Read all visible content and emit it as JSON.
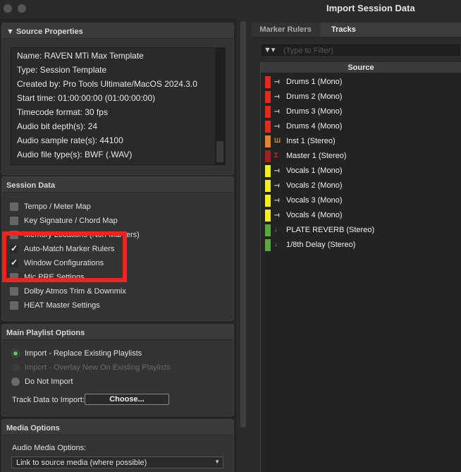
{
  "window": {
    "title": "Import Session Data"
  },
  "source_properties": {
    "header": "▼ Source Properties",
    "lines": [
      "Name: RAVEN MTi Max Template",
      "Type: Session Template",
      "Created by: Pro Tools Ultimate/MacOS 2024.3.0",
      "Start time: 01:00:00:00 (01:00:00:00)",
      "Timecode format: 30 fps",
      "Audio bit depth(s): 24",
      "Audio sample rate(s): 44100",
      "Audio file type(s): BWF (.WAV)"
    ]
  },
  "session_data": {
    "header": "Session Data",
    "items": [
      {
        "label": "Tempo / Meter Map",
        "checked": false
      },
      {
        "label": "Key Signature / Chord Map",
        "checked": false
      },
      {
        "label": "Memory Locations (Non-Markers)",
        "checked": false
      },
      {
        "label": "Auto-Match Marker Rulers",
        "checked": true
      },
      {
        "label": "Window Configurations",
        "checked": true
      },
      {
        "label": "Mic PRE Settings",
        "checked": false
      },
      {
        "label": "Dolby Atmos Trim & Downmix",
        "checked": false
      },
      {
        "label": "HEAT Master Settings",
        "checked": false
      }
    ]
  },
  "main_playlist": {
    "header": "Main Playlist Options",
    "options": [
      {
        "label": "Import - Replace Existing Playlists",
        "state": "selected"
      },
      {
        "label": "Import - Overlay New On Existing Playlists",
        "state": "disabled"
      },
      {
        "label": "Do Not Import",
        "state": "unselected"
      }
    ],
    "track_data_label": "Track Data to Import:",
    "choose_label": "Choose..."
  },
  "media_options": {
    "header": "Media Options",
    "audio_media_label": "Audio Media Options:",
    "audio_media_value": "Link to source media (where possible)"
  },
  "tabs": {
    "marker_rulers": "Marker Rulers",
    "tracks": "Tracks"
  },
  "filter": {
    "placeholder": "(Type to Filter)"
  },
  "tracks": {
    "header": "Source",
    "items": [
      {
        "name": "Drums 1 (Mono)",
        "color": "#e8281e",
        "icon": "audio-track-icon"
      },
      {
        "name": "Drums 2 (Mono)",
        "color": "#e8281e",
        "icon": "audio-track-icon"
      },
      {
        "name": "Drums 3 (Mono)",
        "color": "#e8281e",
        "icon": "audio-track-icon"
      },
      {
        "name": "Drums 4 (Mono)",
        "color": "#e8281e",
        "icon": "audio-track-icon"
      },
      {
        "name": "Inst 1 (Stereo)",
        "color": "#e0852a",
        "icon": "instrument-track-icon"
      },
      {
        "name": "Master 1 (Stereo)",
        "color": "#a51f1f",
        "icon": "master-track-icon"
      },
      {
        "name": "Vocals 1 (Mono)",
        "color": "#f2ef1e",
        "icon": "audio-track-icon"
      },
      {
        "name": "Vocals 2 (Mono)",
        "color": "#f2ef1e",
        "icon": "audio-track-icon"
      },
      {
        "name": "Vocals 3 (Mono)",
        "color": "#f2ef1e",
        "icon": "audio-track-icon"
      },
      {
        "name": "Vocals 4 (Mono)",
        "color": "#f2ef1e",
        "icon": "audio-track-icon"
      },
      {
        "name": "PLATE REVERB (Stereo)",
        "color": "#5aa83a",
        "icon": "aux-track-icon"
      },
      {
        "name": "1/8th Delay (Stereo)",
        "color": "#5aa83a",
        "icon": "aux-track-icon"
      }
    ]
  }
}
